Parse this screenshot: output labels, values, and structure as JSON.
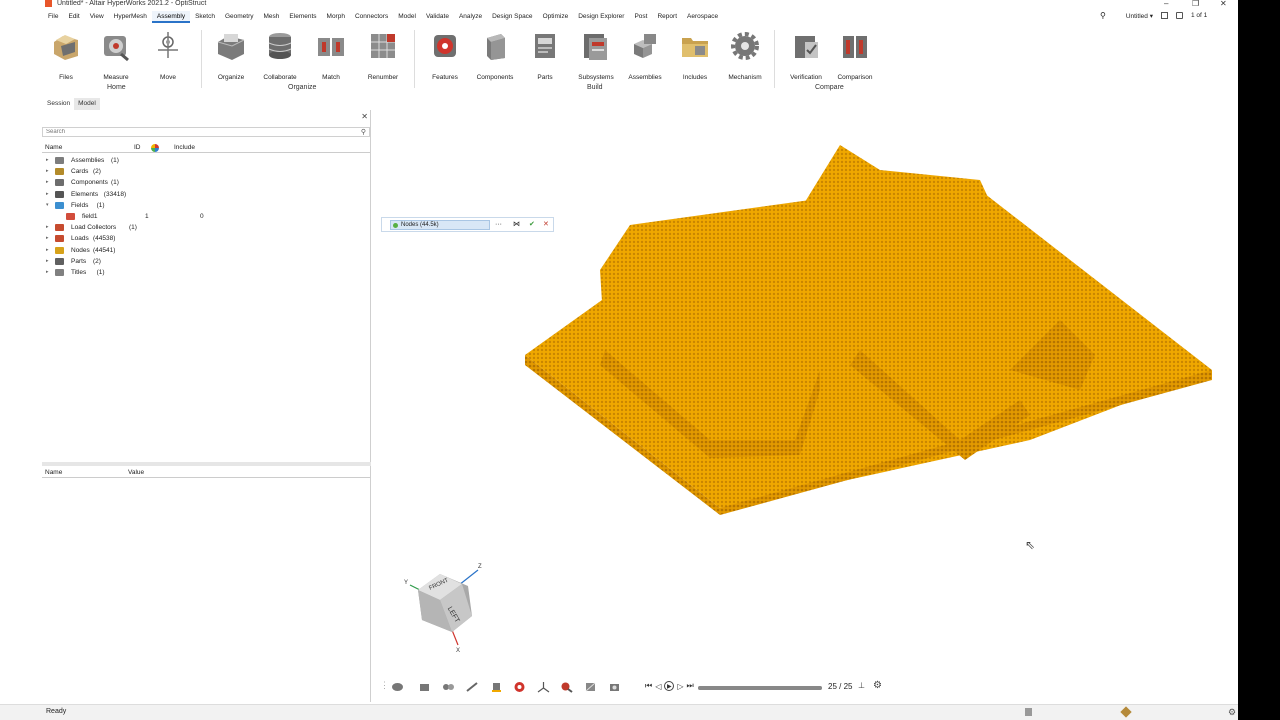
{
  "window": {
    "title": "Untitled* - Altair HyperWorks 2021.2 - OptiStruct",
    "controls": [
      "–",
      "❐",
      "✕"
    ]
  },
  "menu": {
    "items": [
      "File",
      "Edit",
      "View",
      "HyperMesh",
      "Assembly",
      "Sketch",
      "Geometry",
      "Mesh",
      "Elements",
      "Morph",
      "Connectors",
      "Model",
      "Validate",
      "Analyze",
      "Design Space",
      "Optimize",
      "Design Explorer",
      "Post",
      "Report",
      "Aerospace"
    ],
    "active": "Assembly",
    "session_name": "Untitled ▾",
    "page_indicator": "1 of 1"
  },
  "ribbon": {
    "tools": {
      "files": "Files",
      "measure": "Measure",
      "move": "Move",
      "organize": "Organize",
      "collaborate": "Collaborate",
      "match": "Match",
      "renumber": "Renumber",
      "features": "Features",
      "components": "Components",
      "parts": "Parts",
      "subsystems": "Subsystems",
      "assemblies": "Assemblies",
      "includes": "Includes",
      "mechanism": "Mechanism",
      "verification": "Verification",
      "comparison": "Comparison"
    },
    "groups": {
      "home": "Home",
      "organize": "Organize",
      "build": "Build",
      "compare": "Compare"
    }
  },
  "panel": {
    "tabs": [
      "Session",
      "Model"
    ],
    "active_tab": "Model",
    "search_placeholder": "Search",
    "columns": {
      "name": "Name",
      "id": "ID",
      "include": "Include"
    },
    "tree": [
      {
        "name": "Assemblies",
        "count": "(1)",
        "color": "#7d7d7d"
      },
      {
        "name": "Cards",
        "count": "(2)",
        "color": "#b38b2a"
      },
      {
        "name": "Components",
        "count": "(1)",
        "color": "#6d6d6d"
      },
      {
        "name": "Elements",
        "count": "(33418)",
        "color": "#555555"
      },
      {
        "name": "Fields",
        "count": "(1)",
        "color": "#3c8fd0",
        "expanded": true
      },
      {
        "name": "field1",
        "count": "",
        "color": "#d24d3c",
        "child": true,
        "id": "1",
        "include": "0"
      },
      {
        "name": "Load Collectors",
        "count": "(1)",
        "color": "#c64b2f"
      },
      {
        "name": "Loads",
        "count": "(44538)",
        "color": "#c64b2f"
      },
      {
        "name": "Nodes",
        "count": "(44541)",
        "color": "#d7a21a"
      },
      {
        "name": "Parts",
        "count": "(2)",
        "color": "#606060"
      },
      {
        "name": "Titles",
        "count": "(1)",
        "color": "#808080"
      }
    ],
    "props_columns": {
      "name": "Name",
      "value": "Value"
    }
  },
  "selector": {
    "label": "Nodes (44.5k)",
    "more": "···",
    "reset": "⋈",
    "ok": "✔",
    "cancel": "✕"
  },
  "view_cube": {
    "front": "FRONT",
    "left": "LEFT",
    "axis_x": "X",
    "axis_y": "Y",
    "axis_z": "Z"
  },
  "animation": {
    "frame_label": "25 / 25",
    "progress": 1.0
  },
  "status": {
    "text": "Ready"
  },
  "colors": {
    "model": "#f2a900",
    "model_dark": "#d68a00",
    "accent": "#2a73c8"
  }
}
